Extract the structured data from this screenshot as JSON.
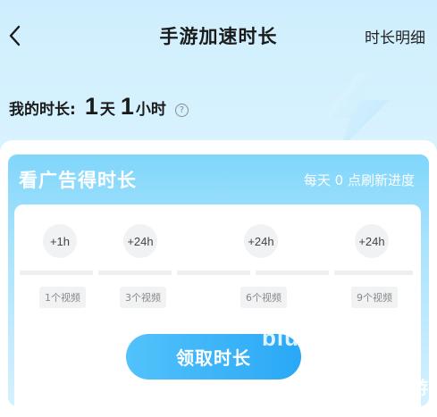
{
  "header": {
    "back_icon": "chevron-left-icon",
    "title": "手游加速时长",
    "detail_link": "时长明细"
  },
  "balance": {
    "label": "我的时长:",
    "days_value": "1",
    "days_unit": "天",
    "hours_value": "1",
    "hours_unit": "小时",
    "help_icon": "question-circle-icon"
  },
  "ad_panel": {
    "title": "看广告得时长",
    "refresh_note": "每天 0 点刷新进度",
    "milestones": [
      {
        "reward": "+1h",
        "requirement": "1个视频"
      },
      {
        "reward": "+24h",
        "requirement": "3个视频"
      },
      {
        "reward": "+24h",
        "requirement": "6个视频"
      },
      {
        "reward": "+24h",
        "requirement": "9个视频"
      }
    ],
    "progress_fraction": 0,
    "claim_button": "领取时长"
  },
  "watermark": {
    "text": "biu",
    "logo_text": "九游"
  },
  "colors": {
    "accent": "#2aa8f6",
    "panel_top": "#7fd6fb",
    "background_top": "#cfeefd"
  }
}
